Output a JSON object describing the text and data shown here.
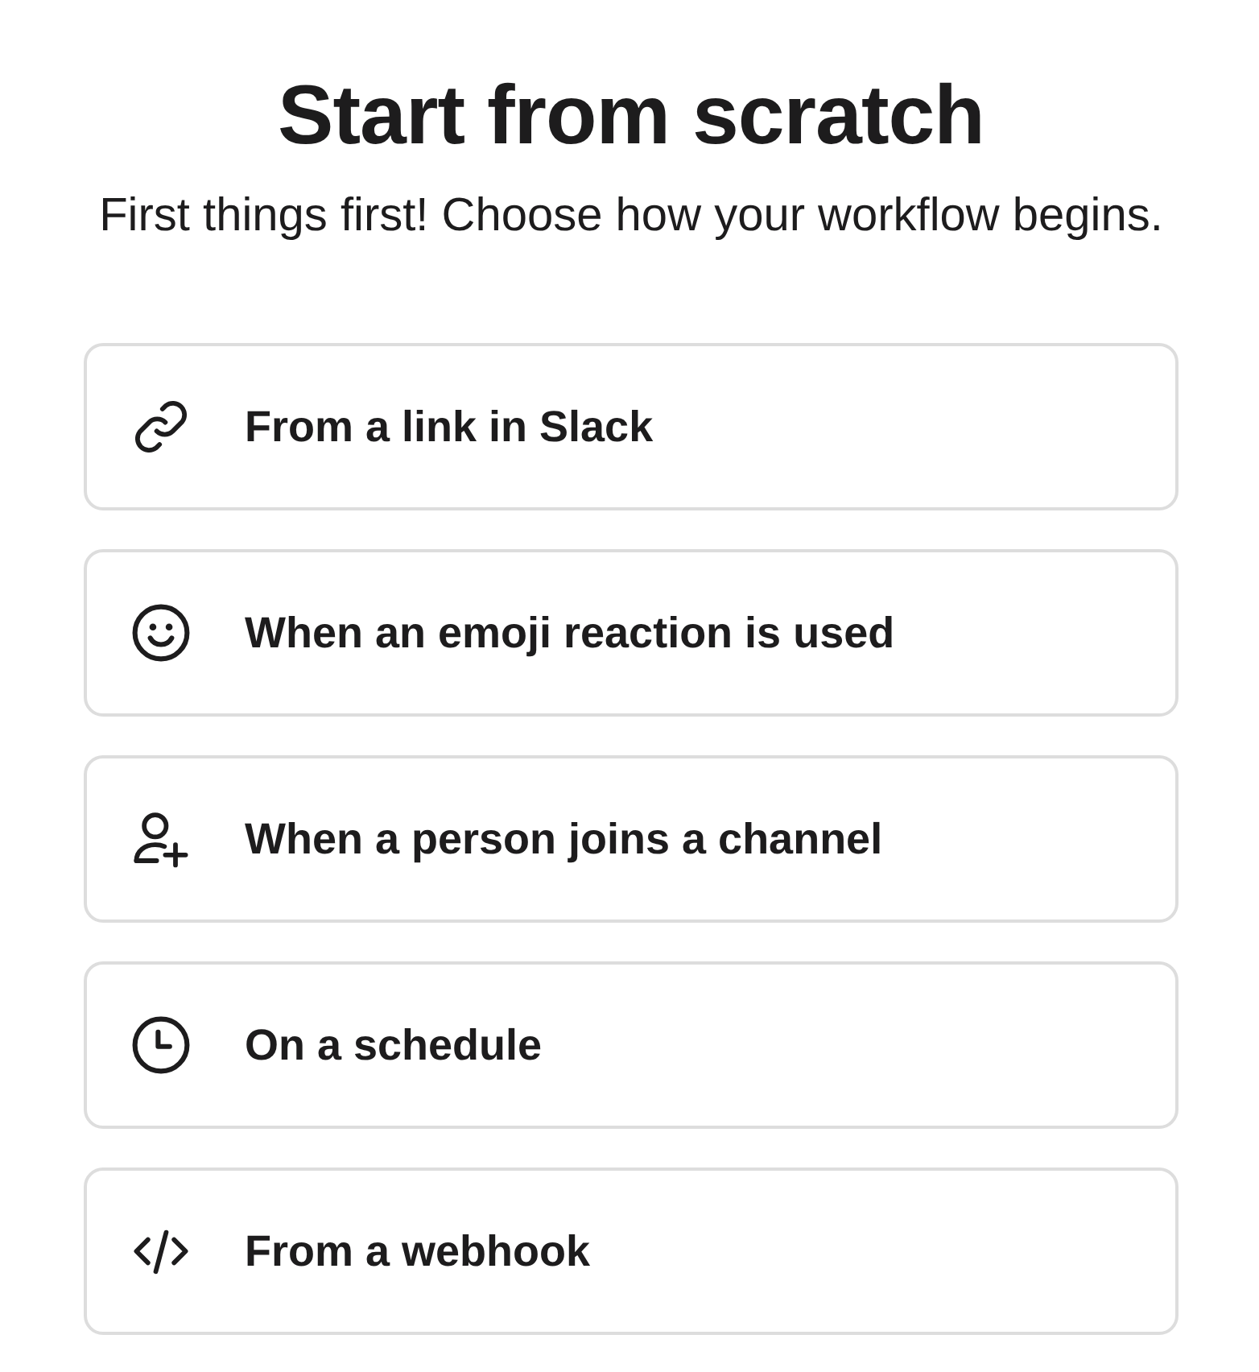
{
  "header": {
    "title": "Start from scratch",
    "subtitle": "First things first! Choose how your workflow begins."
  },
  "options": [
    {
      "kind": "link",
      "label": "From a link in Slack"
    },
    {
      "kind": "emoji",
      "label": "When an emoji reaction is used"
    },
    {
      "kind": "person",
      "label": "When a person joins a channel"
    },
    {
      "kind": "schedule",
      "label": "On a schedule"
    },
    {
      "kind": "webhook",
      "label": "From a webhook"
    }
  ]
}
